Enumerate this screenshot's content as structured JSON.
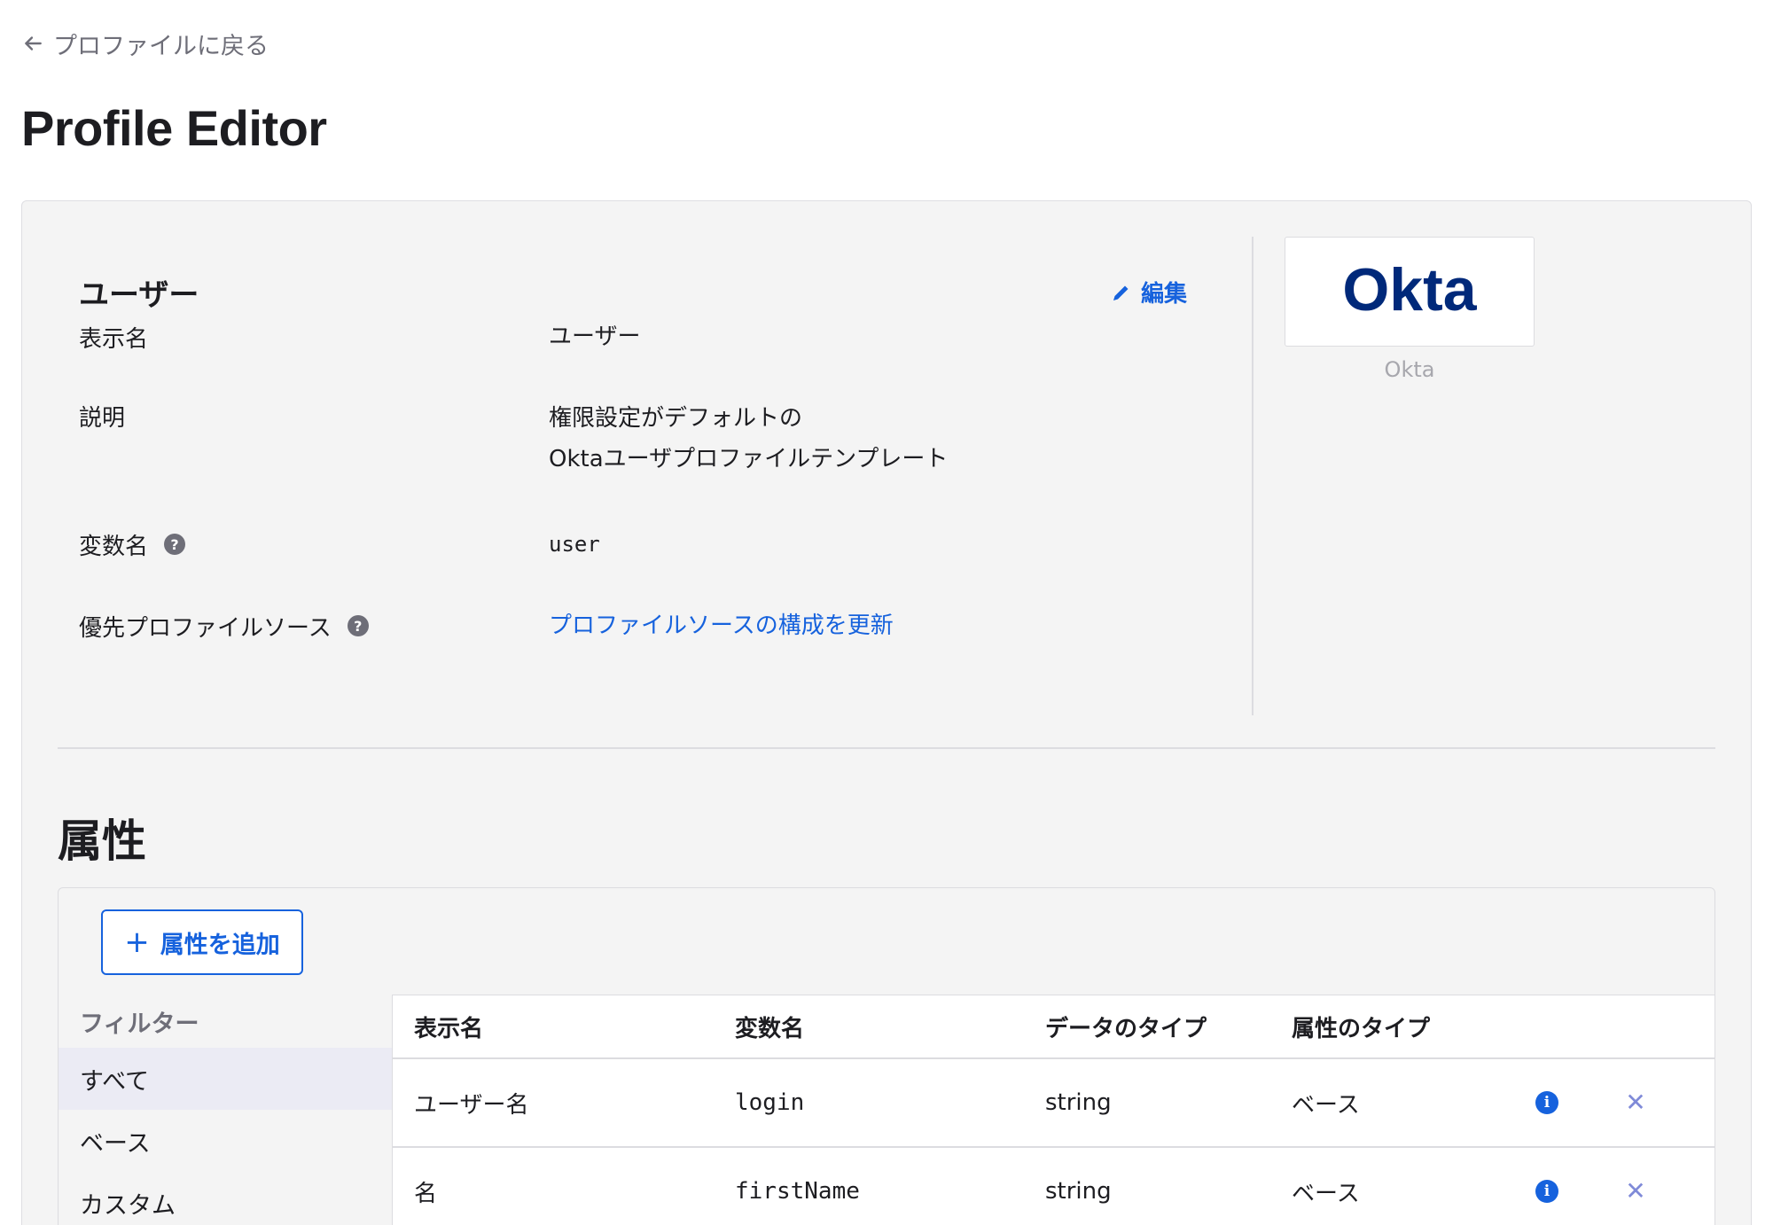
{
  "back_link": {
    "label": "プロファイルに戻る",
    "icon": "arrow-left-icon"
  },
  "page_title": "Profile Editor",
  "profile": {
    "title": "ユーザー",
    "edit_label": "編集",
    "fields": [
      {
        "label": "表示名",
        "value": "ユーザー"
      },
      {
        "label": "説明",
        "value_lines": [
          "権限設定がデフォルトの",
          "Oktaユーザプロファイルテンプレート"
        ]
      },
      {
        "label": "変数名",
        "value": "user",
        "help": "?"
      },
      {
        "label": "優先プロファイルソース",
        "link": "プロファイルソースの構成を更新",
        "help": "?"
      }
    ]
  },
  "logo": {
    "caption": "Okta",
    "brand_color": "#00297a"
  },
  "attributes": {
    "title": "属性",
    "add_button": "属性を追加",
    "filter": {
      "heading": "フィルター",
      "items": [
        "すべて",
        "ベース",
        "カスタム"
      ],
      "active": "すべて"
    },
    "columns": [
      "表示名",
      "変数名",
      "データのタイプ",
      "属性のタイプ"
    ],
    "rows": [
      {
        "display_name": "ユーザー名",
        "variable": "login",
        "data_type": "string",
        "attr_type": "ベース"
      },
      {
        "display_name": "名",
        "variable": "firstName",
        "data_type": "string",
        "attr_type": "ベース"
      }
    ]
  },
  "colors": {
    "accent": "#1662dd",
    "panel_bg": "#f4f4f4"
  }
}
